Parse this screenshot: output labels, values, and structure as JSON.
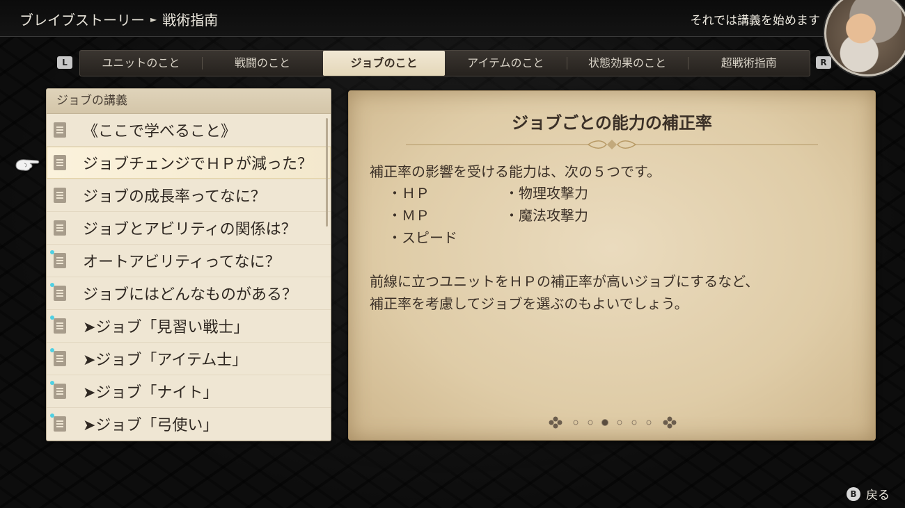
{
  "header": {
    "breadcrumb_parent": "ブレイブストーリー",
    "breadcrumb_current": "戦術指南",
    "hint": "それでは講義を始めます"
  },
  "tabs": {
    "left_shoulder": "L",
    "right_shoulder": "R",
    "items": [
      {
        "label": "ユニットのこと",
        "active": false
      },
      {
        "label": "戦闘のこと",
        "active": false
      },
      {
        "label": "ジョブのこと",
        "active": true
      },
      {
        "label": "アイテムのこと",
        "active": false
      },
      {
        "label": "状態効果のこと",
        "active": false
      },
      {
        "label": "超戦術指南",
        "active": false
      }
    ]
  },
  "list": {
    "heading": "ジョブの講義",
    "items": [
      {
        "label": "《ここで学べること》",
        "new": false,
        "selected": false
      },
      {
        "label": "ジョブチェンジでＨＰが減った？",
        "new": false,
        "selected": true
      },
      {
        "label": "ジョブの成長率ってなに？",
        "new": false,
        "selected": false
      },
      {
        "label": "ジョブとアビリティの関係は？",
        "new": false,
        "selected": false
      },
      {
        "label": "オートアビリティってなに？",
        "new": true,
        "selected": false
      },
      {
        "label": "ジョブにはどんなものがある？",
        "new": true,
        "selected": false
      },
      {
        "label": "➤ジョブ「見習い戦士」",
        "new": true,
        "selected": false
      },
      {
        "label": "➤ジョブ「アイテム士」",
        "new": true,
        "selected": false
      },
      {
        "label": "➤ジョブ「ナイト」",
        "new": true,
        "selected": false
      },
      {
        "label": "➤ジョブ「弓使い」",
        "new": true,
        "selected": false
      }
    ]
  },
  "article": {
    "title": "ジョブごとの能力の補正率",
    "intro": "補正率の影響を受ける能力は、次の５つです。",
    "stat_hp": "・ＨＰ",
    "stat_mp": "・ＭＰ",
    "stat_speed": "・スピード",
    "stat_patk": "・物理攻撃力",
    "stat_matk": "・魔法攻撃力",
    "advice_line1": "前線に立つユニットをＨＰの補正率が高いジョブにするなど、",
    "advice_line2": "補正率を考慮してジョブを選ぶのもよいでしょう。"
  },
  "pager": {
    "total_pages": 6,
    "current_page": 3
  },
  "footer": {
    "button": "B",
    "back_label": "戻る"
  },
  "colors": {
    "new_dot": "#4fd0e3",
    "active_tab": "#efe5cf",
    "parchment": "#e6d5b4"
  }
}
